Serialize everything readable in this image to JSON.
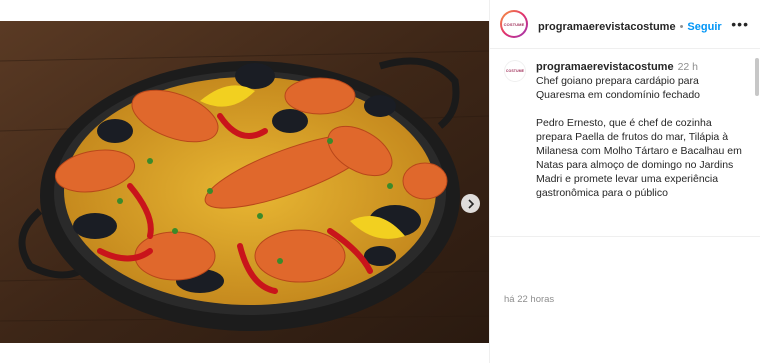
{
  "media": {
    "image_alt": "Paella de frutos do mar em panela",
    "next_icon": "chevron-right-icon",
    "carousel_dots": [
      {
        "active": true
      },
      {
        "active": false
      }
    ]
  },
  "header": {
    "avatar_text": "COSTUME",
    "username": "programaerevistacostume",
    "separator": "•",
    "follow_label": "Seguir",
    "more_icon": "•••"
  },
  "caption": {
    "username": "programaerevistacostume",
    "time": "22 h",
    "paragraph1": "Chef goiano prepara cardápio para Quaresma em condomínio fechado",
    "paragraph2": "Pedro Ernesto, que é chef de cozinha prepara Paella de frutos do mar, Tilápia à Milanesa com Molho Tártaro e Bacalhau em Natas para almoço de domingo no Jardins Madri e promete levar uma experiência gastronômica para o público"
  },
  "footer": {
    "timestamp": "há 22 horas"
  }
}
